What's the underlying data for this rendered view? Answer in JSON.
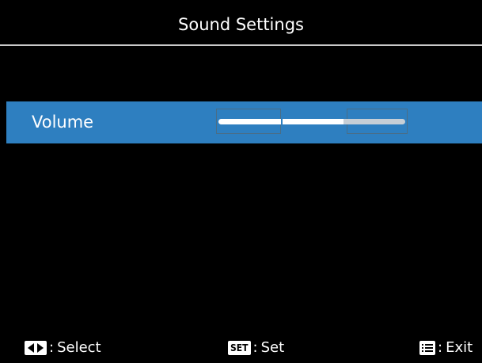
{
  "header": {
    "title": "Sound Settings"
  },
  "menu": {
    "items": [
      {
        "label": "Volume",
        "selected": true,
        "level_fraction": 0.67
      }
    ]
  },
  "footer": {
    "select": {
      "icon": "left-right-arrows-icon",
      "label": "Select"
    },
    "set": {
      "icon": "set-button-icon",
      "icon_text": "SET",
      "label": "Set"
    },
    "exit": {
      "icon": "menu-list-icon",
      "label": "Exit"
    },
    "separator": ":"
  },
  "colors": {
    "background": "#000000",
    "highlight": "#2e7fc0",
    "text": "#ffffff",
    "slider_fill": "#ffffff",
    "slider_track": "#c7cfd6"
  }
}
